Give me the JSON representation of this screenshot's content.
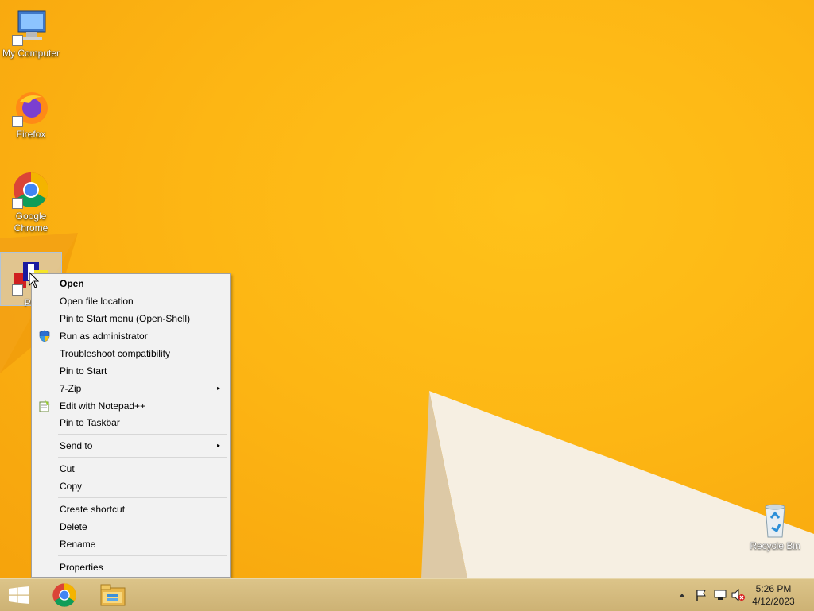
{
  "desktop": {
    "icons": [
      {
        "label": "My Computer",
        "icon": "computer-icon"
      },
      {
        "label": "Firefox",
        "icon": "firefox-icon"
      },
      {
        "label": "Google Chrome",
        "icon": "chrome-icon"
      },
      {
        "label": "PC",
        "icon": "pc-app-icon"
      },
      {
        "label": "Recycle Bin",
        "icon": "recycle-bin-icon"
      }
    ]
  },
  "context_menu": {
    "items": [
      {
        "label": "Open",
        "bold": true
      },
      {
        "label": "Open file location"
      },
      {
        "label": "Pin to Start menu (Open-Shell)"
      },
      {
        "label": "Run as administrator",
        "icon": "uac-shield-icon"
      },
      {
        "label": "Troubleshoot compatibility"
      },
      {
        "label": "Pin to Start"
      },
      {
        "label": "7-Zip",
        "submenu": true
      },
      {
        "label": "Edit with Notepad++",
        "icon": "notepad-plus-plus-icon"
      },
      {
        "label": "Pin to Taskbar"
      },
      {
        "label": "Send to",
        "submenu": true
      },
      {
        "label": "Cut"
      },
      {
        "label": "Copy"
      },
      {
        "label": "Create shortcut"
      },
      {
        "label": "Delete"
      },
      {
        "label": "Rename"
      },
      {
        "label": "Properties"
      }
    ],
    "submenu_arrow": "▸"
  },
  "taskbar": {
    "pinned": [
      "windows-start-icon",
      "chrome-icon",
      "file-explorer-icon"
    ],
    "tray": [
      "show-hidden-icons-icon",
      "action-center-flag-icon",
      "network-icon",
      "volume-muted-icon"
    ],
    "clock": {
      "time": "5:26 PM",
      "date": "4/12/2023"
    }
  },
  "colors": {
    "wallpaper": "#fdb614",
    "menu_bg": "#f2f2f2",
    "taskbar": "#d4bb7f"
  }
}
